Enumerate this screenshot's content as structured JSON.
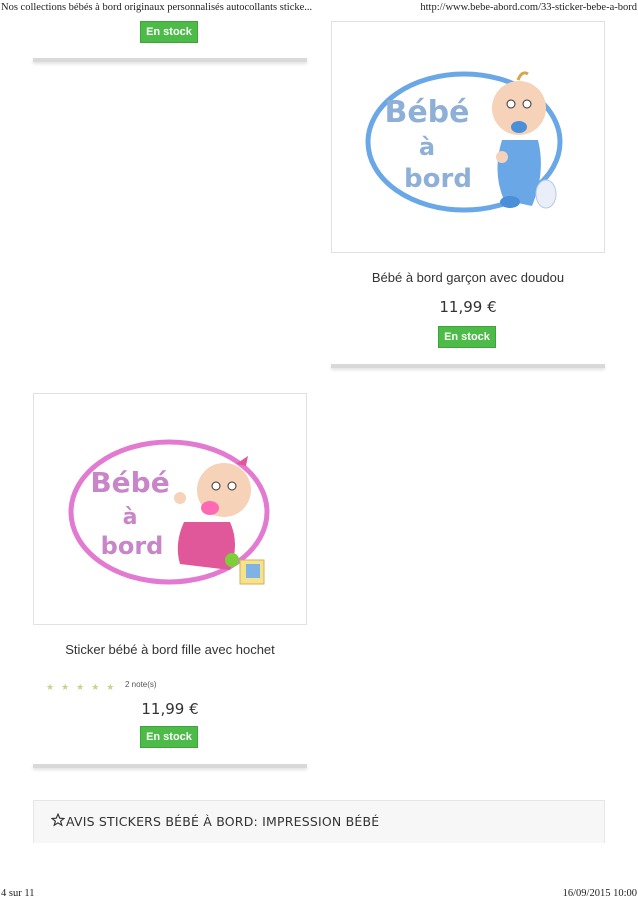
{
  "print_header": {
    "title": "Nos collections bébés à bord originaux personnalisés autocollants sticke...",
    "url": "http://www.bebe-abord.com/33-sticker-bebe-a-bord"
  },
  "print_footer": {
    "page": "4 sur 11",
    "datetime": "16/09/2015 10:00"
  },
  "colors": {
    "stock_green": "#4cbb47",
    "boy_blue": "#6aa7e6",
    "girl_pink": "#e27ad1"
  },
  "products": [
    {
      "stock_label": "En stock"
    },
    {
      "image_text": [
        "Bébé",
        "à",
        "bord"
      ],
      "name": "Bébé à bord garçon avec doudou",
      "price": "11,99 €",
      "stock_label": "En stock"
    },
    {
      "image_text": [
        "Bébé",
        "à",
        "bord"
      ],
      "name": "Sticker bébé à bord fille avec hochet",
      "rating_stars": "★★★★★",
      "rating_count": "2 note(s)",
      "price": "11,99 €",
      "stock_label": "En stock"
    }
  ],
  "reviews": {
    "icon": "star-outline-icon",
    "title": "AVIS STICKERS BÉBÉ À BORD: IMPRESSION BÉBÉ"
  }
}
